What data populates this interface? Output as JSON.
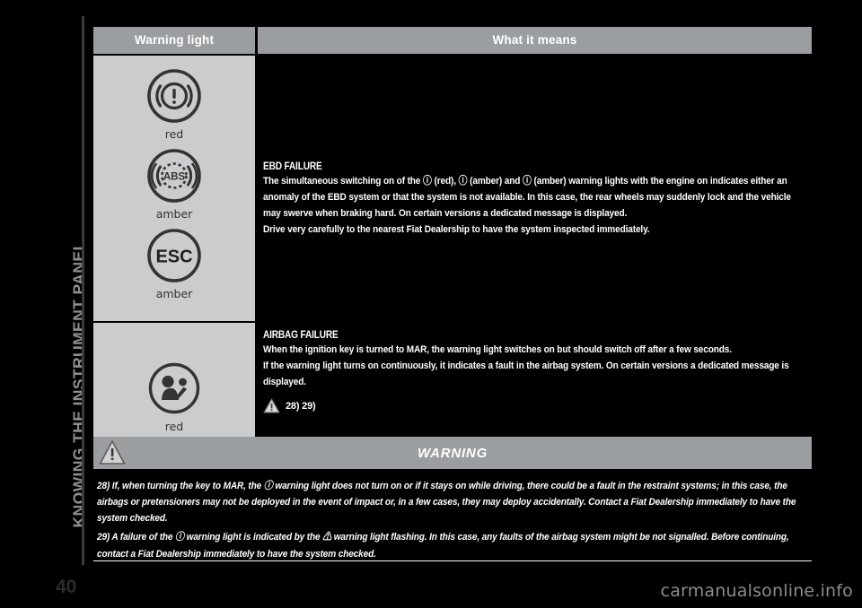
{
  "chapter": {
    "title": "KNOWING THE INSTRUMENT PANEL",
    "page_number": "40"
  },
  "footer": {
    "watermark": "carmanualsonline.info"
  },
  "table": {
    "headers": {
      "warning_light": "Warning light",
      "what_it_means": "What it means"
    },
    "rows": [
      {
        "lamps": [
          {
            "icon": "brake-failure-icon",
            "colour": "red"
          },
          {
            "icon": "abs-icon",
            "colour": "amber"
          },
          {
            "icon": "esc-icon",
            "colour": "amber"
          }
        ],
        "title": "EBD FAILURE",
        "paragraphs": [
          "The simultaneous switching on of the ⓘ (red), ⓘ (amber) and ⓘ (amber) warning lights with the engine on indicates either an anomaly of the EBD system or that the system is not available. In this case, the rear wheels may suddenly lock and the vehicle may swerve when braking hard. On certain versions a dedicated message is displayed.",
          "Drive very carefully to the nearest Fiat Dealership to have the system inspected immediately."
        ],
        "refs": ""
      },
      {
        "lamps": [
          {
            "icon": "airbag-icon",
            "colour": "red"
          }
        ],
        "title": "AIRBAG FAILURE",
        "paragraphs": [
          "When the ignition key is turned to MAR, the warning light switches on but should switch off after a few seconds.",
          "If the warning light turns on continuously, it indicates a fault in the airbag system. On certain versions a dedicated message is displayed."
        ],
        "refs": "28) 29)"
      }
    ]
  },
  "warning_box": {
    "heading": "WARNING",
    "icon": "warning-triangle-icon",
    "paragraphs": [
      "28) If, when turning the key to MAR, the ⓘ warning light does not turn on or if it stays on while driving, there could be a fault in the restraint systems; in this case, the airbags or pretensioners may not be deployed in the event of impact or, in a few cases, they may deploy accidentally. Contact a Fiat Dealership immediately to have the system checked.",
      "29) A failure of the ⓘ warning light is indicated by the ⚠ warning light flashing. In this case, any faults of the airbag system might be not signalled. Before continuing, contact a Fiat Dealership immediately to have the system checked."
    ]
  },
  "colors": {
    "page_background": "#000000",
    "header_band": "#9b9ea1",
    "lamp_cell": "#cbcccd",
    "text": "#ffffff",
    "chapter_text": "#8e8e8e"
  }
}
